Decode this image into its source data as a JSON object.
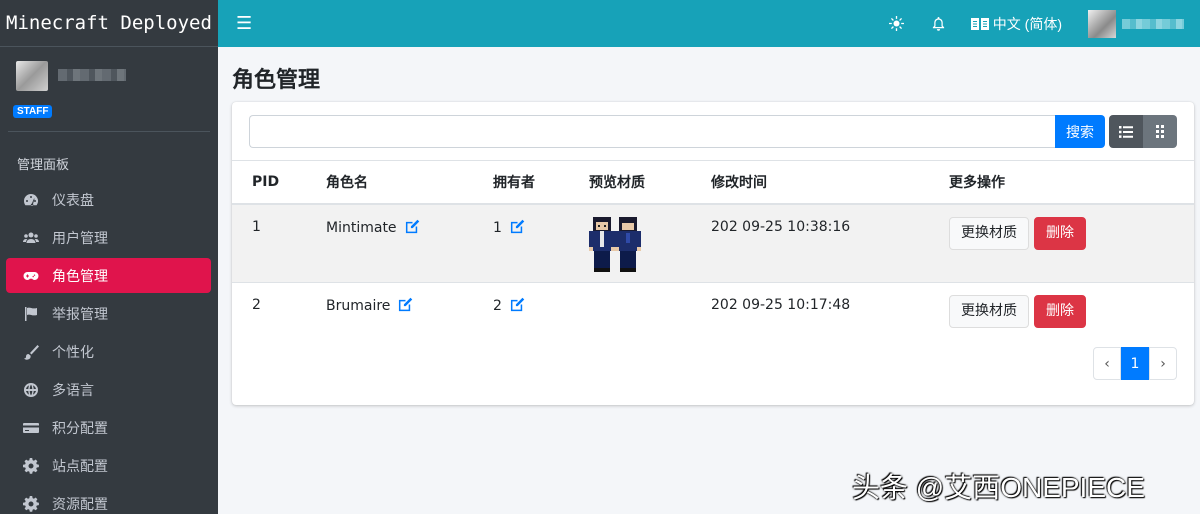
{
  "brand": "Minecraft Deployed",
  "user": {
    "role_badge": "STAFF"
  },
  "sidebar": {
    "header": "管理面板",
    "items": [
      {
        "label": "仪表盘",
        "icon": "dashboard-icon"
      },
      {
        "label": "用户管理",
        "icon": "users-icon"
      },
      {
        "label": "角色管理",
        "icon": "gamepad-icon",
        "active": true
      },
      {
        "label": "举报管理",
        "icon": "flag-icon"
      },
      {
        "label": "个性化",
        "icon": "brush-icon"
      },
      {
        "label": "多语言",
        "icon": "globe-icon"
      },
      {
        "label": "积分配置",
        "icon": "credit-card-icon"
      },
      {
        "label": "站点配置",
        "icon": "gear-icon"
      },
      {
        "label": "资源配置",
        "icon": "cog-icon"
      }
    ]
  },
  "topbar": {
    "language": "中文 (简体)"
  },
  "page_title": "角色管理",
  "search": {
    "placeholder": "",
    "button": "搜索"
  },
  "table": {
    "headers": [
      "PID",
      "角色名",
      "拥有者",
      "预览材质",
      "修改时间",
      "更多操作"
    ],
    "rows": [
      {
        "pid": "1",
        "name": "Mintimate",
        "owner": "1",
        "modified": "202  09-25 10:38:16",
        "has_texture": true
      },
      {
        "pid": "2",
        "name": "Brumaire",
        "owner": "2",
        "modified": "202  09-25 10:17:48",
        "has_texture": false
      }
    ],
    "actions": {
      "change": "更换材质",
      "delete": "删除"
    }
  },
  "pagination": {
    "prev": "‹",
    "current": "1",
    "next": "›"
  },
  "watermark": "头条 @艾西ONEPIECE",
  "colors": {
    "sidebar": "#343a40",
    "topbar": "#17a2b8",
    "active": "#e0144c",
    "primary": "#007bff",
    "danger": "#dc3545"
  }
}
